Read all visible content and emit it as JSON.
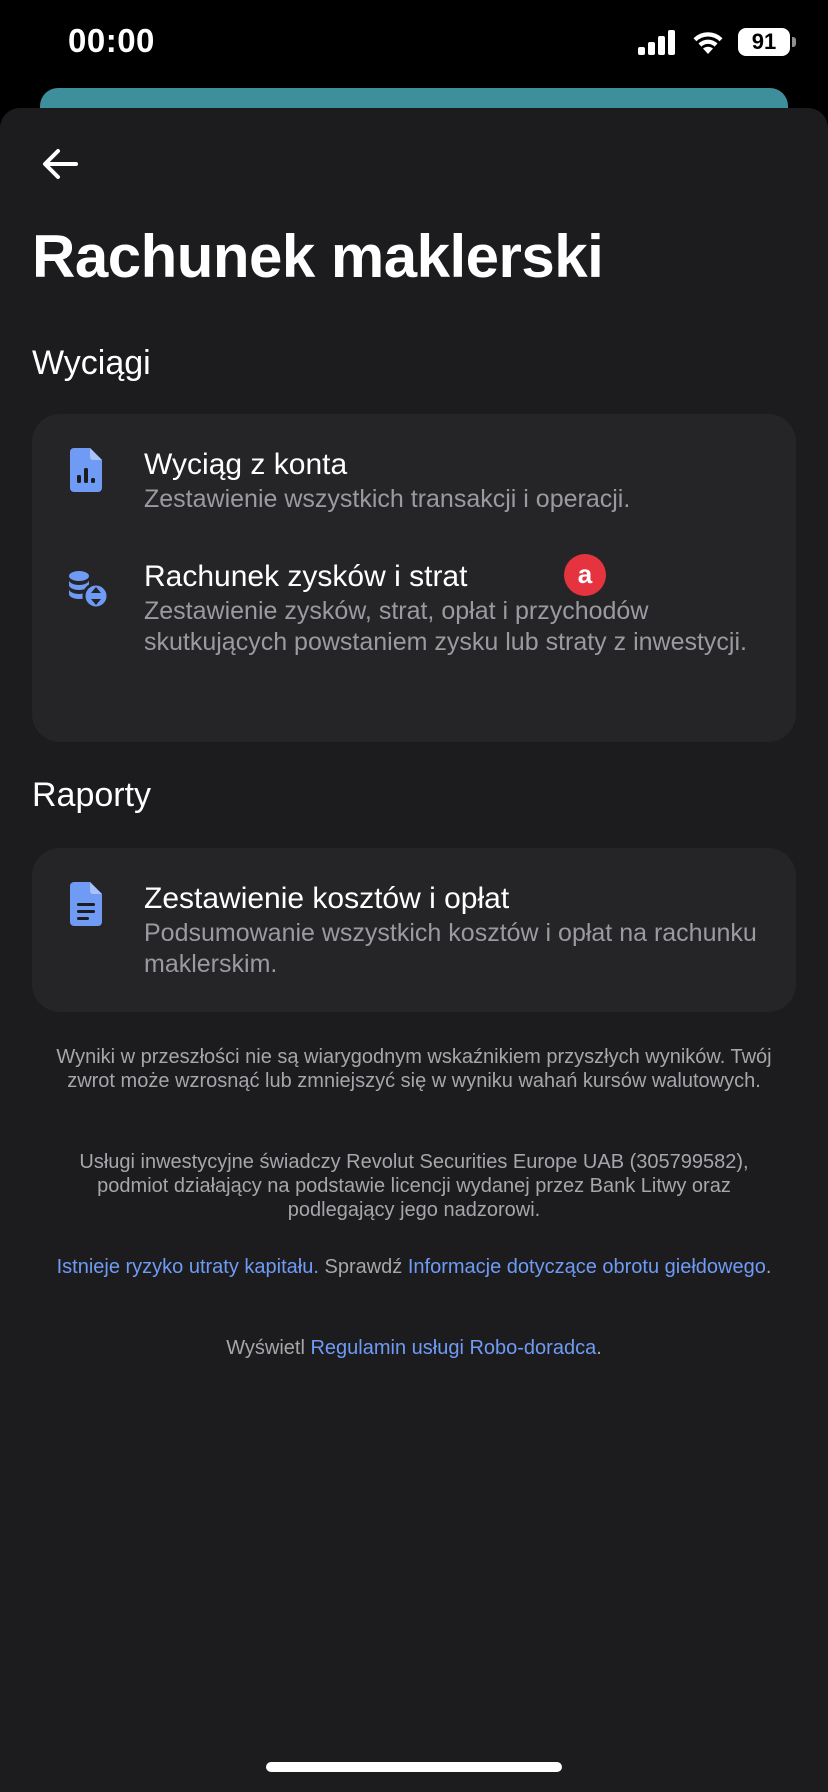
{
  "status_bar": {
    "time": "00:00",
    "battery": "91"
  },
  "header": {
    "title": "Rachunek maklerski"
  },
  "sections": [
    {
      "title": "Wyciągi",
      "items": [
        {
          "title": "Wyciąg z konta",
          "description": "Zestawienie wszystkich transakcji i operacji.",
          "icon": "document-chart-icon"
        },
        {
          "title": "Rachunek zysków i strat",
          "description": "Zestawienie zysków, strat, opłat i przychodów skutkujących powstaniem zysku lub straty z inwestycji.",
          "icon": "coins-exchange-icon",
          "badge": "a"
        }
      ]
    },
    {
      "title": "Raporty",
      "items": [
        {
          "title": "Zestawienie kosztów i opłat",
          "description": "Podsumowanie wszystkich kosztów i opłat na rachunku maklerskim.",
          "icon": "document-lines-icon"
        }
      ]
    }
  ],
  "disclaimers": {
    "past_results": "Wyniki w przeszłości nie są wiarygodnym wskaźnikiem przyszłych wyników. Twój zwrot może wzrosnąć lub zmniejszyć się w wyniku wahań kursów walutowych.",
    "provider": "Usługi inwestycyjne świadczy Revolut Securities Europe UAB (305799582), podmiot działający na podstawie licencji wydanej przez Bank Litwy oraz podlegający jego nadzorowi.",
    "risk_link": "Istnieje ryzyko utraty kapitału.",
    "check_text": " Sprawdź ",
    "info_link": "Informacje dotyczące obrotu giełdowego",
    "period": ".",
    "show_text": "Wyświetl ",
    "robo_link": "Regulamin usługi Robo-doradca",
    "period2": "."
  },
  "colors": {
    "background": "#1c1c1e",
    "card": "#252528",
    "accent_icon": "#6f9bf5",
    "badge": "#e5343f",
    "link": "#6f9bf5",
    "behind_card": "#3d8f9b"
  }
}
